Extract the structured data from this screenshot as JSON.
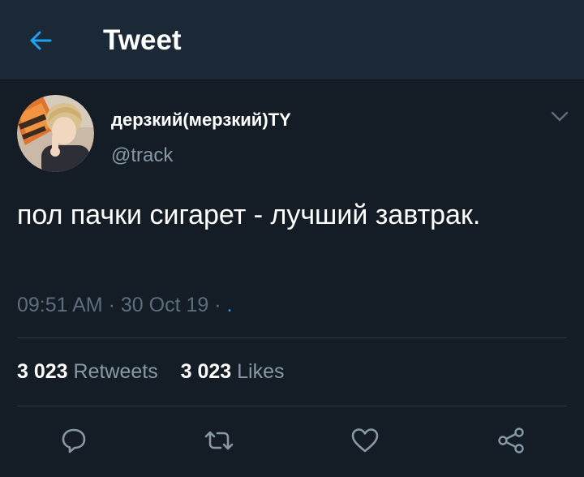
{
  "header": {
    "back_icon": "arrow-left-icon",
    "title": "Tweet",
    "accent_color": "#1da1f2",
    "background_color": "#1b2836"
  },
  "tweet": {
    "author": {
      "display_name": "дерзкий(мерзкий)TY",
      "handle": "@track",
      "avatar": "avatar-photo"
    },
    "text": "пол пачки сигарет - лучший завтрак.",
    "time": "09:51 AM",
    "date": "30 Oct 19",
    "via": ".",
    "menu_icon": "chevron-down-icon"
  },
  "stats": {
    "retweets_count": "3 023",
    "retweets_label": "Retweets",
    "likes_count": "3 023",
    "likes_label": "Likes"
  },
  "actions": [
    {
      "name": "reply",
      "icon": "speech-bubble-icon"
    },
    {
      "name": "retweet",
      "icon": "retweet-icon"
    },
    {
      "name": "like",
      "icon": "heart-icon"
    },
    {
      "name": "share",
      "icon": "share-icon"
    }
  ]
}
